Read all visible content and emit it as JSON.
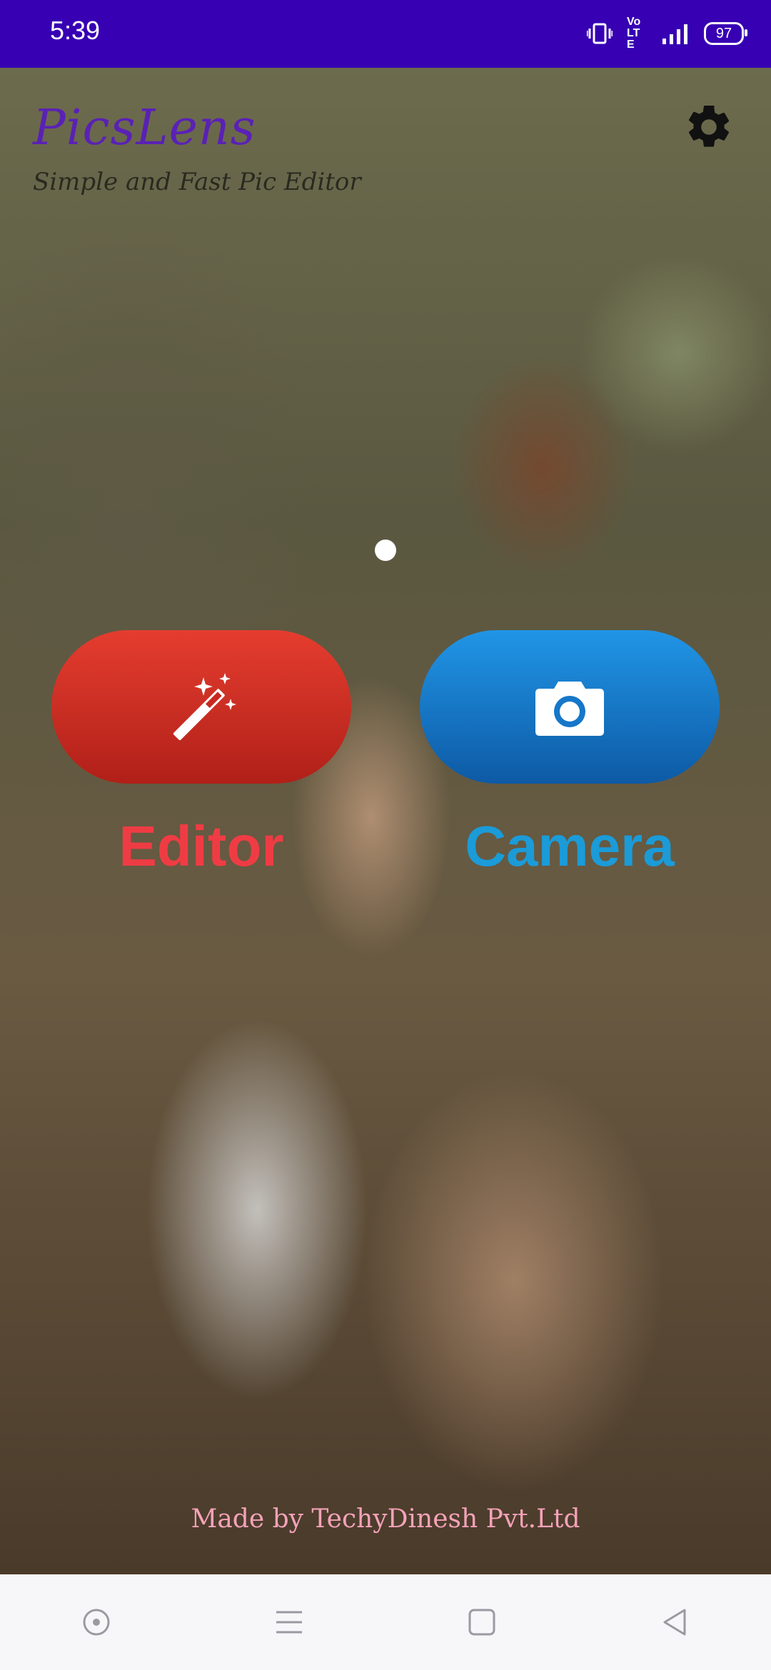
{
  "status_bar": {
    "time": "5:39",
    "network_label": "Vo LTE",
    "battery": "97"
  },
  "header": {
    "app_title": "PicsLens",
    "subtitle": "Simple and Fast Pic Editor",
    "settings_icon": "gear-icon"
  },
  "actions": {
    "editor_label": "Editor",
    "camera_label": "Camera",
    "editor_icon": "magic-wand-icon",
    "camera_icon": "camera-icon"
  },
  "footer": {
    "credit": "Made by TechyDinesh Pvt.Ltd"
  },
  "nav_bar": {
    "items": [
      "assistant-icon",
      "menu-icon",
      "home-icon",
      "back-icon"
    ]
  },
  "colors": {
    "status_bar": "#3700b3",
    "editor_button": "#c8281f",
    "camera_button": "#1677c9",
    "editor_text": "#ef3c44",
    "camera_text": "#1b9bd8",
    "title": "#5a21b5",
    "credit": "#f4a2b9"
  }
}
